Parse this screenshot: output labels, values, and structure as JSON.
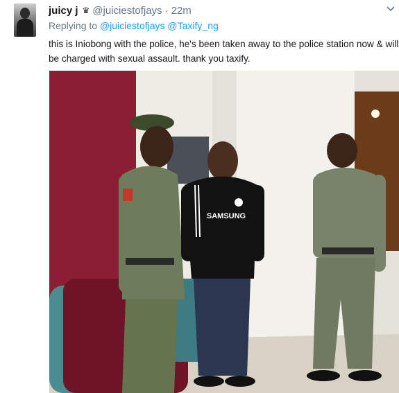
{
  "tweet": {
    "name": "juicy j",
    "badge_icon": "crown-icon",
    "handle": "@juiciestofjays",
    "separator": "·",
    "time": "22m",
    "replying_prefix": "Replying to",
    "reply_to": [
      "@juiciestofjays",
      "@Taxify_ng"
    ],
    "text": "this is Iniobong with the police, he's been taken away to the police station now & will be charged with sexual assault. thank you taxify.",
    "menu_icon": "chevron-down-icon",
    "photo": {
      "jersey_text": "SAMSUNG"
    }
  }
}
